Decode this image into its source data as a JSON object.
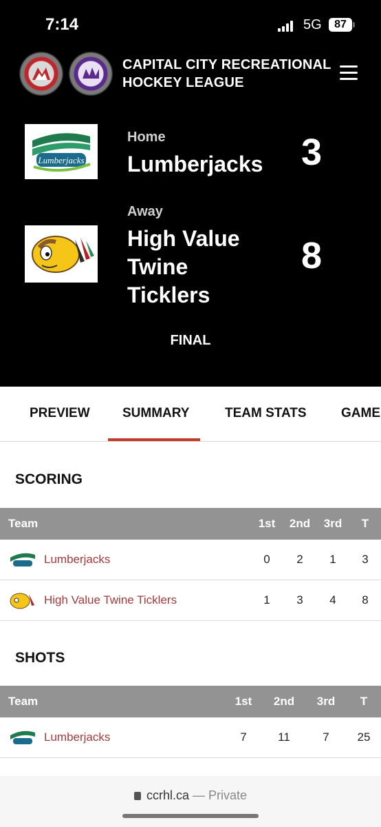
{
  "status": {
    "time": "7:14",
    "network": "5G",
    "battery": "87"
  },
  "header": {
    "title_line1": "CAPITAL CITY RECREATIONAL",
    "title_line2": "HOCKEY LEAGUE"
  },
  "game": {
    "home": {
      "label": "Home",
      "name": "Lumberjacks",
      "score": "3"
    },
    "away": {
      "label": "Away",
      "name_line1": "High Value",
      "name_line2": "Twine",
      "name_line3": "Ticklers",
      "score": "8"
    },
    "status": "FINAL"
  },
  "tabs": [
    "PREVIEW",
    "SUMMARY",
    "TEAM STATS",
    "GAMES"
  ],
  "active_tab": "SUMMARY",
  "scoring": {
    "title": "SCORING",
    "headers": [
      "Team",
      "1st",
      "2nd",
      "3rd",
      "T"
    ],
    "rows": [
      {
        "team": "Lumberjacks",
        "p1": "0",
        "p2": "2",
        "p3": "1",
        "t": "3"
      },
      {
        "team": "High Value Twine Ticklers",
        "p1": "1",
        "p2": "3",
        "p3": "4",
        "t": "8"
      }
    ]
  },
  "shots": {
    "title": "SHOTS",
    "headers": [
      "Team",
      "1st",
      "2nd",
      "3rd",
      "T"
    ],
    "rows": [
      {
        "team": "Lumberjacks",
        "p1": "7",
        "p2": "11",
        "p3": "7",
        "t": "25"
      }
    ]
  },
  "browser": {
    "domain": "ccrhl.ca",
    "separator": "—",
    "mode": "Private"
  },
  "colors": {
    "accent": "#c0392b",
    "link": "#a33a3a",
    "table_header": "#939393"
  }
}
